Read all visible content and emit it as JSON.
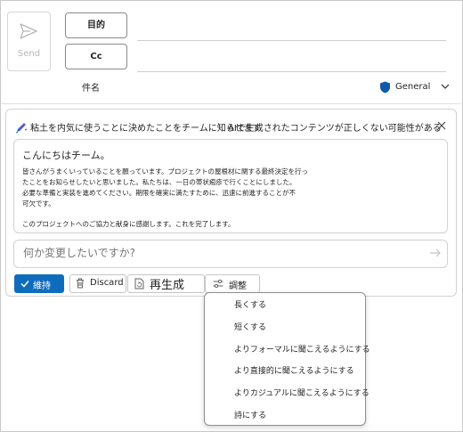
{
  "header": {
    "send_label": "Send",
    "to_label": "目的",
    "cc_label": "Cc",
    "subject_label": "件名",
    "sensitivity_label": "General"
  },
  "copilot": {
    "prompt": "粘土を内気に使うことに決めたことをチームに知らせます",
    "ai_warning": "AIで生成されたコンテンツが正しくない可能性がある",
    "draft": {
      "greeting": "こんにちはチーム。",
      "lines": [
        "皆さんがうまくいっていることを願っています。プロジェクトの屋根材に関する最終決定を行っ",
        "たことをお知らせしたいと思いました。私たちは、一日の帯状疱疹で行くことにしました。",
        "必要な準備と実装を進めてください。期限を確実に満たすために、迅速に前進することが不",
        "可欠です。",
        "",
        "このプロジェクトへのご協力と献身に感謝します。これを完了します。"
      ]
    },
    "ask_placeholder": "何か変更したいですか?",
    "buttons": {
      "keep": "維持",
      "discard": "Discard",
      "regenerate": "再生成",
      "adjust": "調整"
    }
  },
  "adjust_menu": {
    "items": [
      "長くする",
      "短くする",
      "よりフォーマルに聞こえるようにする",
      "より直接的に聞こえるようにする",
      "よりカジュアルに聞こえるようにする",
      "詩にする"
    ]
  },
  "colors": {
    "accent": "#0f6cbd",
    "border": "#d1d1d1",
    "disabled_text": "#b7b7b7"
  }
}
